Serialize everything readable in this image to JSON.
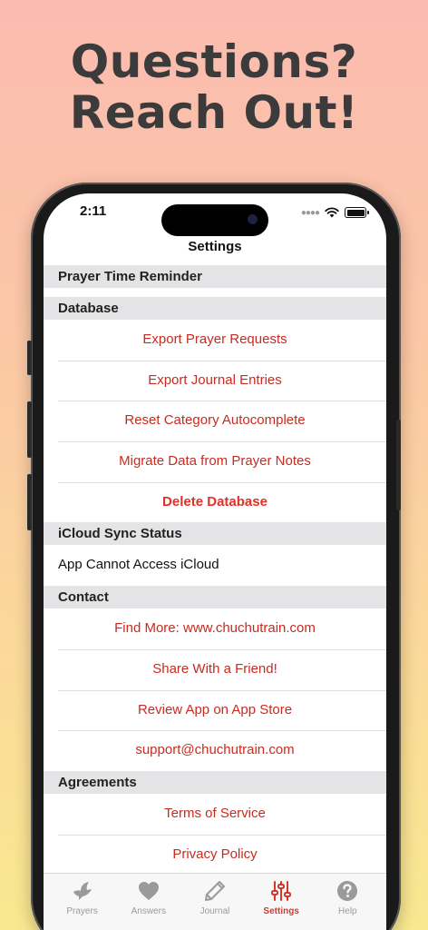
{
  "headline": {
    "line1": "Questions?",
    "line2": "Reach Out!"
  },
  "status_bar": {
    "time": "2:11",
    "icons": [
      "signal-dots-icon",
      "wifi-icon",
      "battery-icon"
    ]
  },
  "nav": {
    "title": "Settings"
  },
  "sections": {
    "prayer_time": {
      "header": "Prayer Time Reminder"
    },
    "database": {
      "header": "Database",
      "export_requests": "Export Prayer Requests",
      "export_journal": "Export Journal Entries",
      "reset_autocomplete": "Reset Category Autocomplete",
      "migrate": "Migrate Data from Prayer Notes",
      "delete": "Delete Database"
    },
    "icloud": {
      "header": "iCloud Sync Status",
      "status": "App Cannot Access iCloud"
    },
    "contact": {
      "header": "Contact",
      "find_more": "Find More: www.chuchutrain.com",
      "share": "Share With a Friend!",
      "review": "Review App on App Store",
      "email": "support@chuchutrain.com"
    },
    "agreements": {
      "header": "Agreements",
      "terms": "Terms of Service",
      "privacy": "Privacy Policy"
    }
  },
  "tabbar": {
    "active": "settings",
    "prayers": "Prayers",
    "answers": "Answers",
    "journal": "Journal",
    "settings": "Settings",
    "help": "Help"
  },
  "colors": {
    "accent": "#c92b20",
    "destructive": "#e0302a",
    "section_bg": "#e4e4e6",
    "headline": "#3b3b3b"
  }
}
